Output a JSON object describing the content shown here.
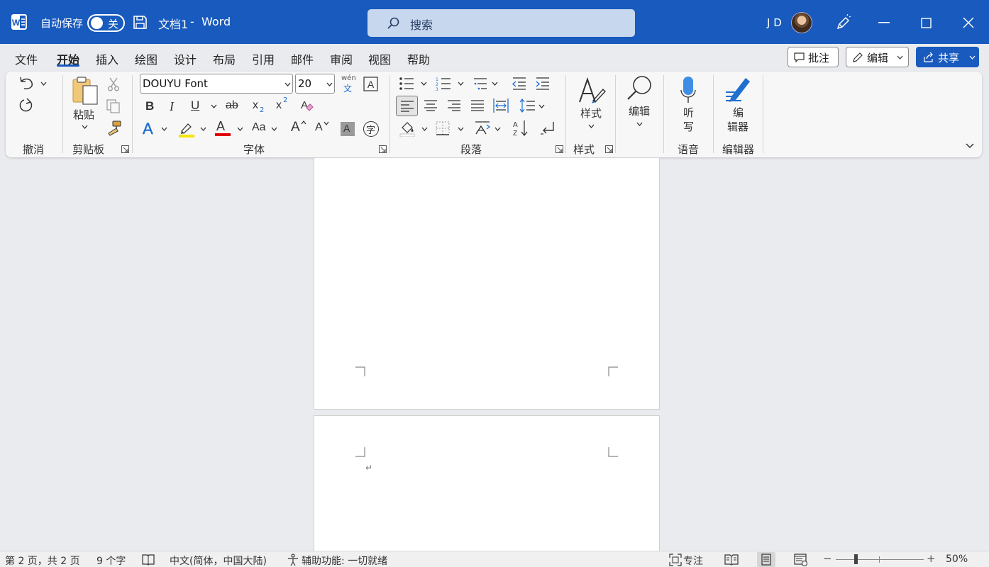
{
  "titlebar": {
    "autosave_label": "自动保存",
    "autosave_state": "关",
    "doc_title": "文档1",
    "separator": "-",
    "app_name": "Word",
    "search_placeholder": "搜索",
    "user_initials": "J D",
    "brand_color": "#185abd"
  },
  "menu": {
    "tabs": [
      "文件",
      "开始",
      "插入",
      "绘图",
      "设计",
      "布局",
      "引用",
      "邮件",
      "审阅",
      "视图",
      "帮助"
    ],
    "active_tab": "开始",
    "comment_button": "批注",
    "edit_button": "编辑",
    "share_button": "共享"
  },
  "ribbon": {
    "groups": {
      "undo": "撤消",
      "clipboard": "剪贴板",
      "font": "字体",
      "paragraph": "段落",
      "styles": "样式",
      "voice": "语音",
      "editor": "编辑器"
    },
    "paste_label": "粘贴",
    "font_name": "DOUYU Font",
    "font_size": "20",
    "phonetic_top": "wén",
    "phonetic_bottom": "文",
    "bold": "B",
    "italic": "I",
    "underline": "U",
    "strike": "ab",
    "subscript": "x",
    "superscript": "x",
    "change_case": "Aa",
    "grow_font": "A",
    "shrink_font": "A",
    "shade_letter": "A",
    "enclose_char": "字",
    "text_effect": "A",
    "font_color": "A",
    "styles_label": "样式",
    "editing_label": "编辑",
    "dictate_line1": "听",
    "dictate_line2": "写",
    "editor_line1": "编",
    "editor_line2": "辑器",
    "highlight_color": "#f5e400",
    "font_color_value": "#e00000"
  },
  "document": {
    "paragraph_mark": "↵"
  },
  "status": {
    "page_info": "第 2 页，共 2 页",
    "word_count": "9 个字",
    "language": "中文(简体，中国大陆)",
    "accessibility": "辅助功能: 一切就绪",
    "focus": "专注",
    "zoom": "50%"
  }
}
